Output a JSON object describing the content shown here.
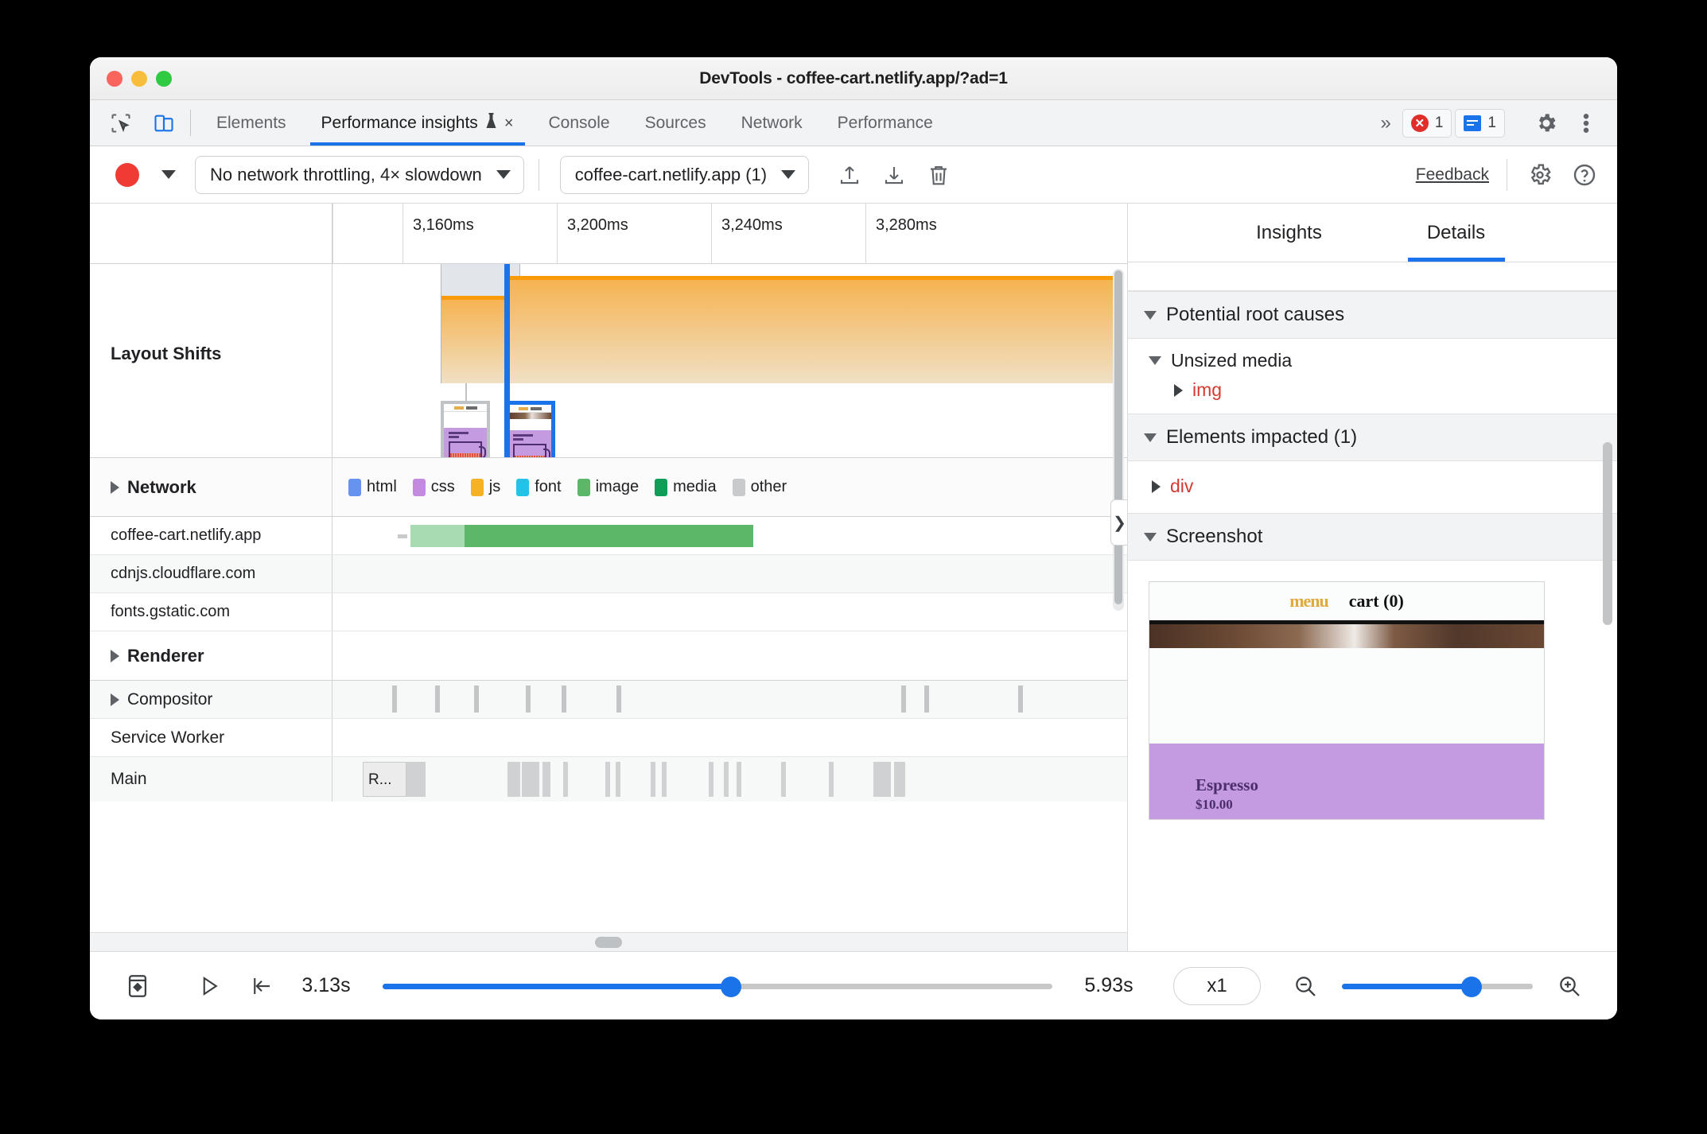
{
  "window": {
    "title": "DevTools - coffee-cart.netlify.app/?ad=1"
  },
  "tabbar": {
    "icons": [
      "inspect-cursor-icon",
      "device-toolbar-icon"
    ],
    "tabs": [
      {
        "label": "Elements",
        "active": false
      },
      {
        "label": "Performance insights",
        "active": true,
        "experimental": true,
        "closable": true
      },
      {
        "label": "Console",
        "active": false
      },
      {
        "label": "Sources",
        "active": false
      },
      {
        "label": "Network",
        "active": false
      },
      {
        "label": "Performance",
        "active": false
      }
    ],
    "overflow_label": "»",
    "error_count": "1",
    "message_count": "1",
    "settings_icon": "gear-icon",
    "more_icon": "kebab-menu-icon",
    "close_glyph": "×",
    "experiment_glyph": "⚗"
  },
  "toolbar": {
    "record_label": "record-button",
    "throttling": "No network throttling, 4× slowdown",
    "page_select": "coffee-cart.netlify.app (1)",
    "upload_icon": "upload-icon",
    "download_icon": "download-icon",
    "trash_icon": "trash-icon",
    "feedback": "Feedback",
    "settings_icon": "gear-icon",
    "help_icon": "help-icon",
    "caret": "▼"
  },
  "timeline": {
    "ruler_ticks": [
      "3,160ms",
      "3,200ms",
      "3,240ms",
      "3,280ms"
    ],
    "rows": [
      {
        "name": "Layout Shifts",
        "type": "layout-shifts",
        "bold": true,
        "expandable": false
      },
      {
        "name": "Network",
        "type": "group",
        "bold": true,
        "expandable": true
      },
      {
        "name": "coffee-cart.netlify.app",
        "type": "request"
      },
      {
        "name": "cdnjs.cloudflare.com",
        "type": "request"
      },
      {
        "name": "fonts.gstatic.com",
        "type": "request"
      },
      {
        "name": "Renderer",
        "type": "group",
        "bold": true,
        "expandable": true
      },
      {
        "name": "Compositor",
        "type": "subgroup",
        "expandable": true
      },
      {
        "name": "Service Worker",
        "type": "subgroup"
      },
      {
        "name": "Main",
        "type": "subgroup"
      }
    ],
    "network_legend": [
      {
        "label": "html",
        "color": "#6793f0"
      },
      {
        "label": "css",
        "color": "#c48ae0"
      },
      {
        "label": "js",
        "color": "#f5b225"
      },
      {
        "label": "font",
        "color": "#23c2e8"
      },
      {
        "label": "image",
        "color": "#5cb868"
      },
      {
        "label": "media",
        "color": "#0f9d58"
      },
      {
        "label": "other",
        "color": "#c8cacc"
      }
    ],
    "main_task_label": "R..."
  },
  "details": {
    "tabs": [
      {
        "label": "Insights",
        "active": false
      },
      {
        "label": "Details",
        "active": true
      }
    ],
    "sections": [
      {
        "title": "Potential root causes",
        "expanded": true
      },
      {
        "title": "Elements impacted (1)",
        "expanded": true
      },
      {
        "title": "Screenshot",
        "expanded": true
      }
    ],
    "root_cause_group": "Unsized media",
    "root_cause_node": "img",
    "impacted_node": "div",
    "screenshot": {
      "menu": "menu",
      "cart": "cart (0)",
      "product": "Espresso",
      "price": "$10.00"
    },
    "collapse_arrow": "❯"
  },
  "playback": {
    "filmstrip_icon": "filmstrip-icon",
    "play_icon": "play-icon",
    "jump-to-start_icon": "jump-to-start-icon",
    "start_time": "3.13s",
    "end_time": "5.93s",
    "timeline_progress_pct": 52,
    "speed": "x1",
    "zoom_out_icon": "zoom-out-icon",
    "zoom_in_icon": "zoom-in-icon",
    "zoom_pct": 68,
    "accent": "#1a73e8"
  }
}
